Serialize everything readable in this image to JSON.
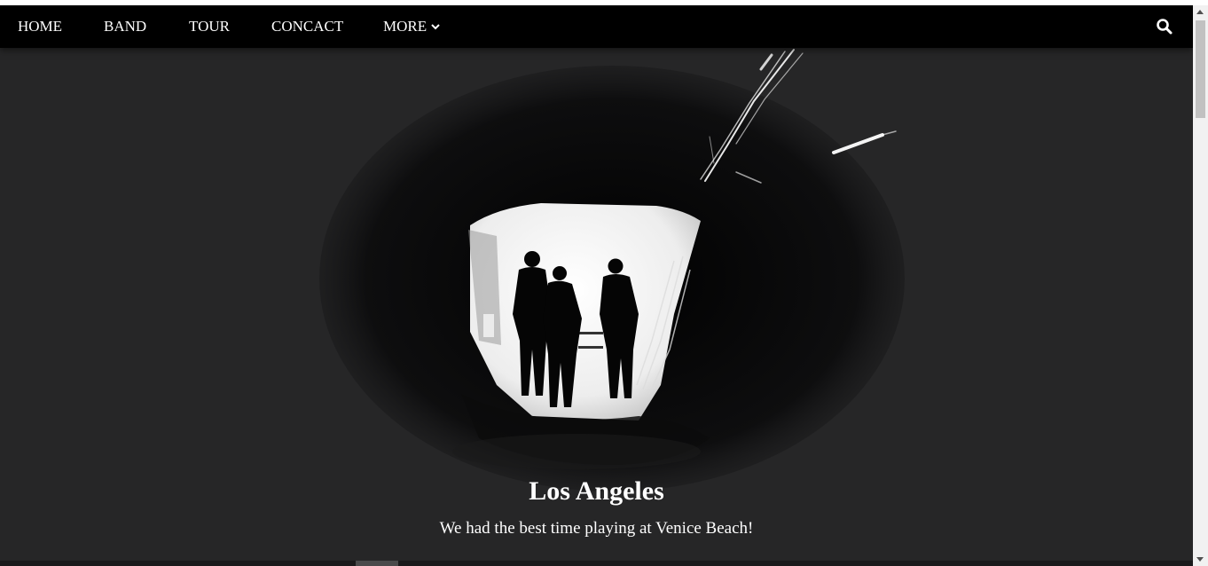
{
  "navbar": {
    "items": [
      {
        "label": "HOME"
      },
      {
        "label": "BAND"
      },
      {
        "label": "TOUR"
      },
      {
        "label": "CONCACT"
      },
      {
        "label": "MORE"
      }
    ],
    "more_icon": "chevron-down-icon",
    "search_icon": "search-icon"
  },
  "hero": {
    "title": "Los Angeles",
    "subtitle": "We had the best time playing at Venice Beach!"
  },
  "colors": {
    "navbar_bg": "#000000",
    "page_bg": "#262627",
    "text": "#ffffff"
  }
}
